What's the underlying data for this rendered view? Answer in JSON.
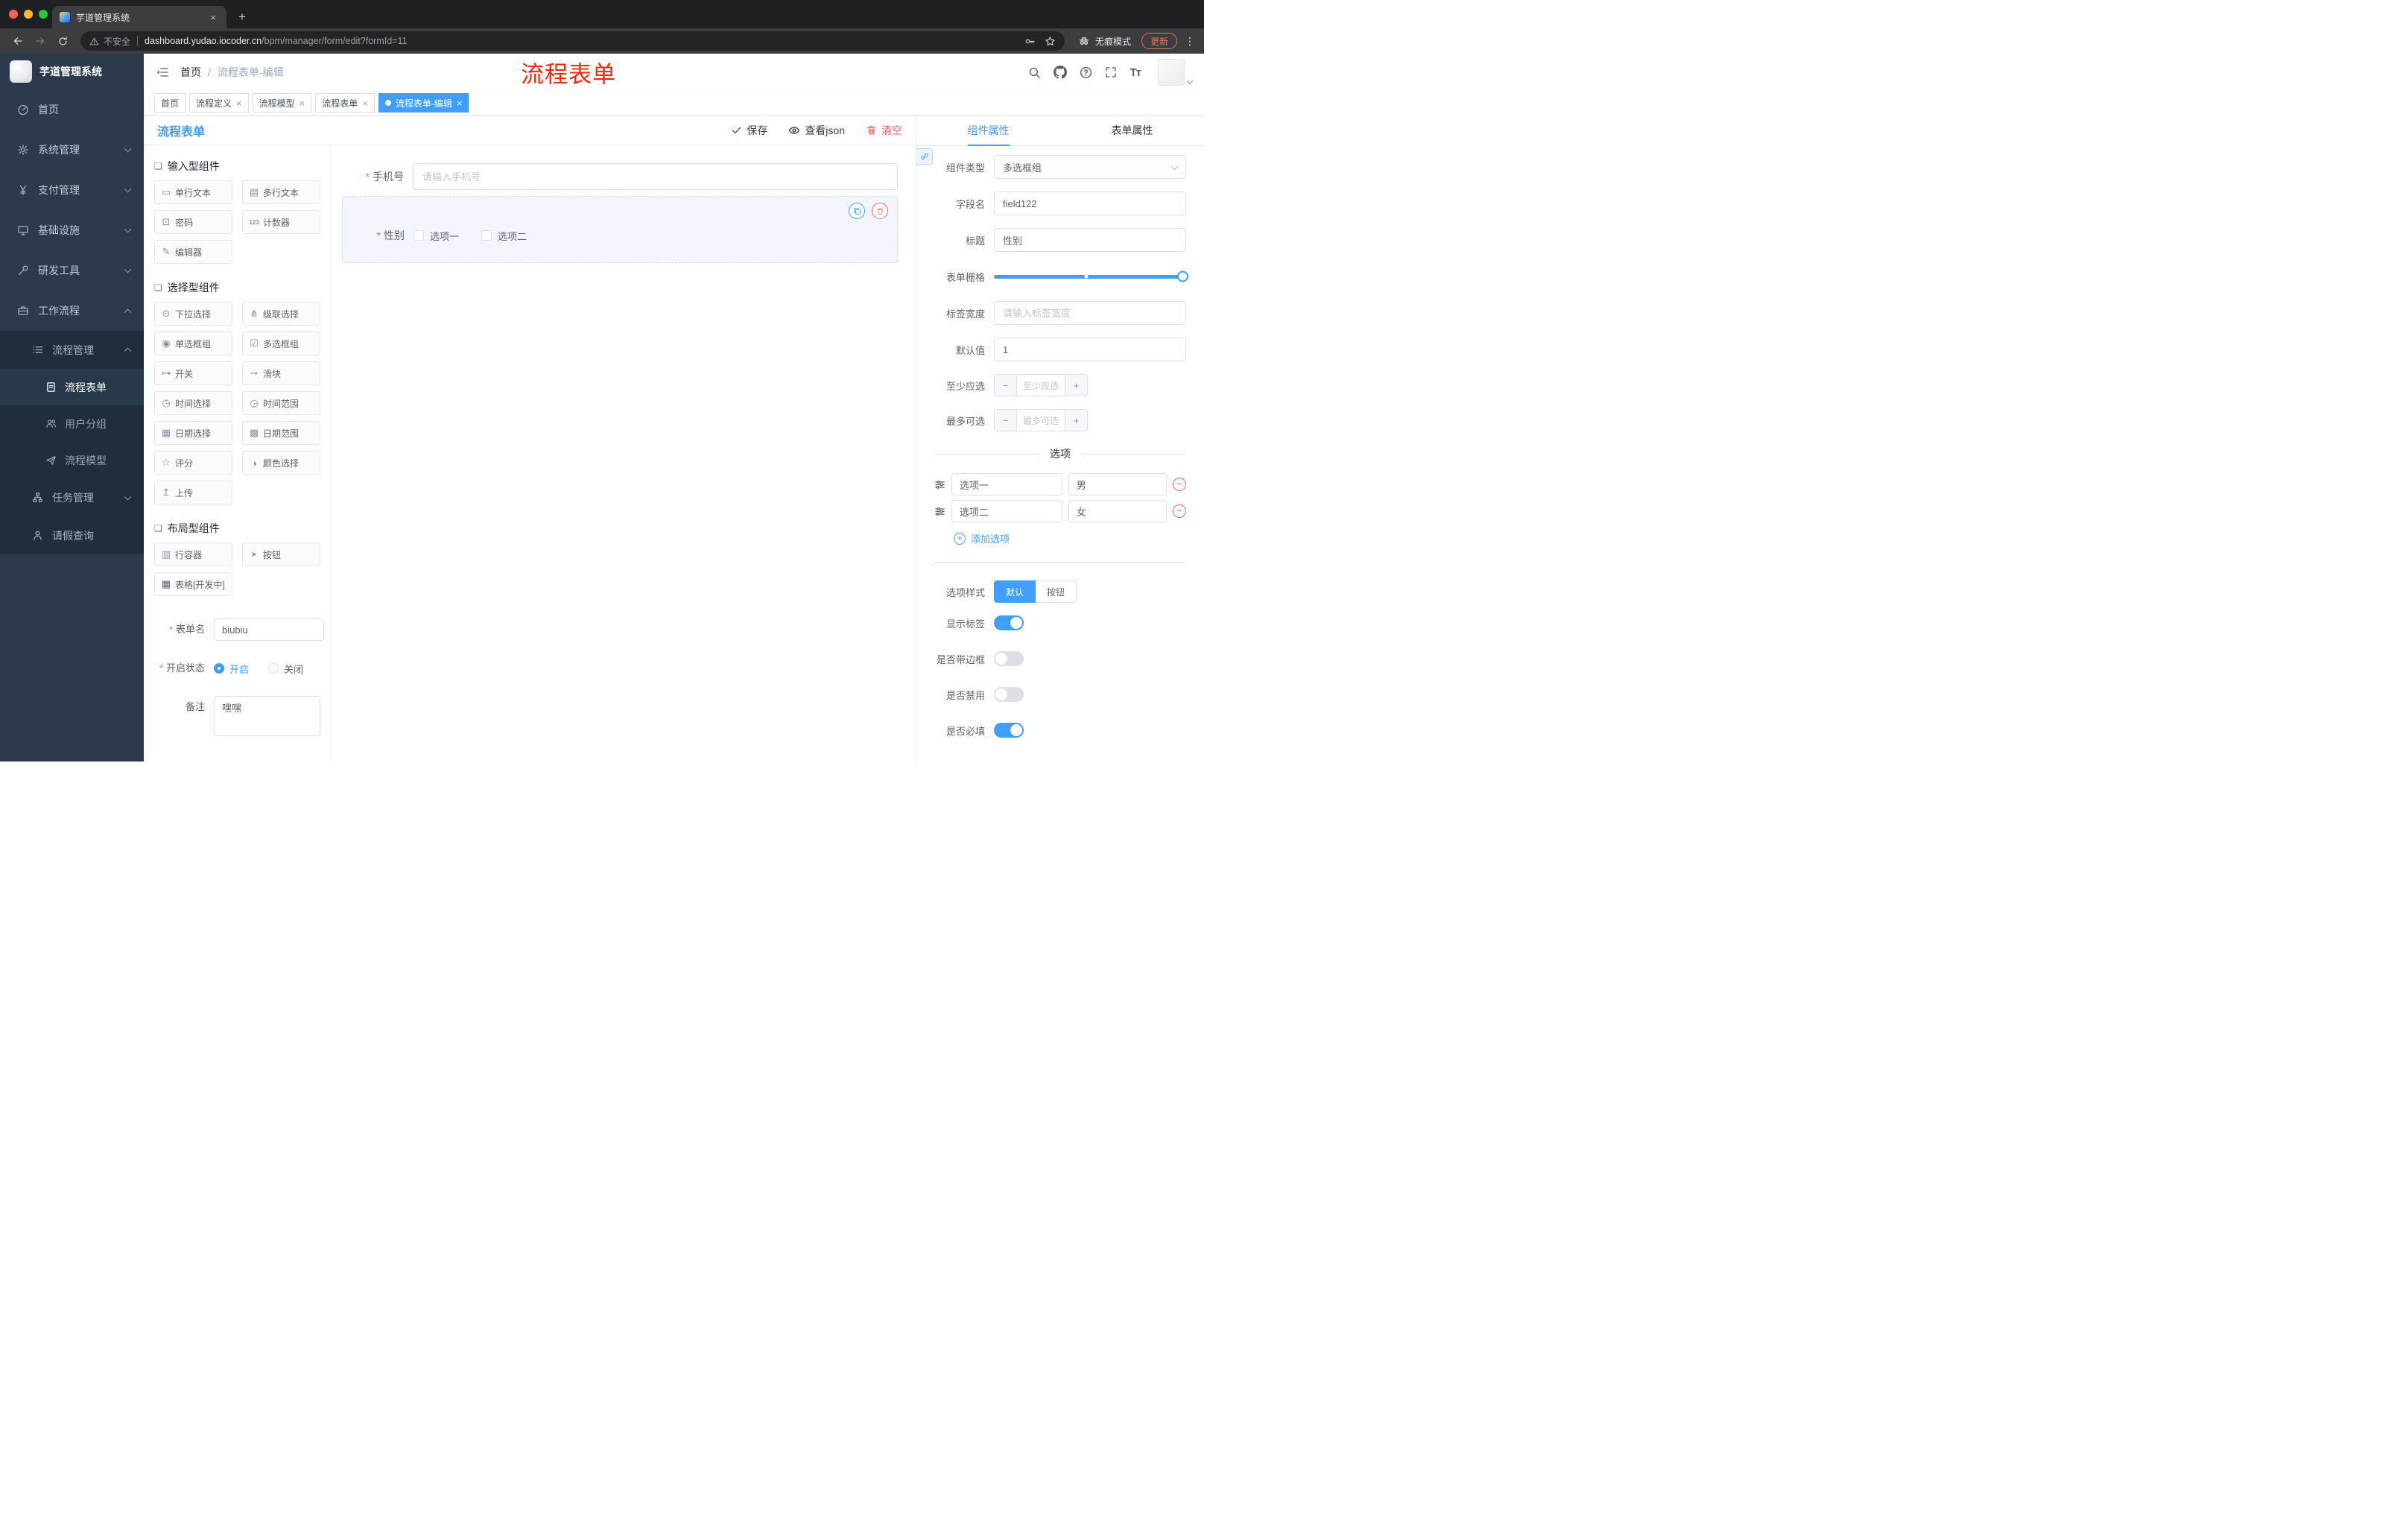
{
  "colors": {
    "primary": "#409EFF",
    "danger": "#F56C6C",
    "annotation": "#FF2404",
    "sidebar_bg": "#2D3A4B",
    "submenu_bg": "#1F2D3D"
  },
  "browser": {
    "tab_title": "芋道管理系统",
    "security_label": "不安全",
    "url_host": "dashboard.yudao.iocoder.cn",
    "url_path": "/bpm/manager/form/edit?formId=11",
    "incognito_label": "无痕模式",
    "update_label": "更新"
  },
  "sidebar": {
    "app_title": "芋道管理系统",
    "items": [
      {
        "label": "首页",
        "icon": "dashboard"
      },
      {
        "label": "系统管理",
        "icon": "gear",
        "expandable": true
      },
      {
        "label": "支付管理",
        "icon": "yen",
        "expandable": true
      },
      {
        "label": "基础设施",
        "icon": "monitor",
        "expandable": true
      },
      {
        "label": "研发工具",
        "icon": "wrench",
        "expandable": true
      },
      {
        "label": "工作流程",
        "icon": "briefcase",
        "expanded": true
      }
    ],
    "workflow_children": {
      "process_mgmt": {
        "label": "流程管理",
        "expanded": true
      },
      "process_children": [
        {
          "label": "流程表单",
          "active": true
        },
        {
          "label": "用户分组"
        },
        {
          "label": "流程模型"
        }
      ],
      "task_mgmt": {
        "label": "任务管理",
        "expandable": true
      },
      "leave_query": {
        "label": "请假查询"
      }
    }
  },
  "header": {
    "breadcrumb_home": "首页",
    "breadcrumb_current": "流程表单-编辑",
    "annotation": "流程表单"
  },
  "tags": [
    {
      "label": "首页",
      "closable": false,
      "active": false
    },
    {
      "label": "流程定义",
      "closable": true,
      "active": false
    },
    {
      "label": "流程模型",
      "closable": true,
      "active": false
    },
    {
      "label": "流程表单",
      "closable": true,
      "active": false
    },
    {
      "label": "流程表单-编辑",
      "closable": true,
      "active": true
    }
  ],
  "designer": {
    "title": "流程表单",
    "save_label": "保存",
    "view_json_label": "查看json",
    "clear_label": "清空"
  },
  "palette": {
    "groups": [
      {
        "title": "输入型组件",
        "items": [
          {
            "label": "单行文本",
            "icon": "single-line-input"
          },
          {
            "label": "多行文本",
            "icon": "multi-line-input"
          },
          {
            "label": "密码",
            "icon": "password"
          },
          {
            "label": "计数器",
            "icon": "counter"
          },
          {
            "label": "编辑器",
            "icon": "rich-editor"
          }
        ]
      },
      {
        "title": "选择型组件",
        "items": [
          {
            "label": "下拉选择",
            "icon": "select"
          },
          {
            "label": "级联选择",
            "icon": "cascader"
          },
          {
            "label": "单选框组",
            "icon": "radio-group"
          },
          {
            "label": "多选框组",
            "icon": "checkbox-group"
          },
          {
            "label": "开关",
            "icon": "switch"
          },
          {
            "label": "滑块",
            "icon": "slider"
          },
          {
            "label": "时间选择",
            "icon": "time-picker"
          },
          {
            "label": "时间范围",
            "icon": "time-range"
          },
          {
            "label": "日期选择",
            "icon": "date-picker"
          },
          {
            "label": "日期范围",
            "icon": "date-range"
          },
          {
            "label": "评分",
            "icon": "rate"
          },
          {
            "label": "颜色选择",
            "icon": "color-picker"
          },
          {
            "label": "上传",
            "icon": "upload"
          }
        ]
      },
      {
        "title": "布局型组件",
        "items": [
          {
            "label": "行容器",
            "icon": "row-container"
          },
          {
            "label": "按钮",
            "icon": "button"
          },
          {
            "label": "表格[开发中]",
            "icon": "table"
          }
        ]
      }
    ]
  },
  "meta_form": {
    "name_label": "表单名",
    "name_value": "biubiu",
    "status_label": "开启状态",
    "status_on_label": "开启",
    "status_off_label": "关闭",
    "status_selected": "开启",
    "remark_label": "备注",
    "remark_value": "嘿嘿"
  },
  "canvas": {
    "phone_field": {
      "label": "手机号",
      "required": true,
      "placeholder": "请输入手机号"
    },
    "gender_field": {
      "label": "性别",
      "required": true,
      "selected": true,
      "options": [
        {
          "label": "选项一"
        },
        {
          "label": "选项二"
        }
      ]
    }
  },
  "props": {
    "tabs": [
      {
        "label": "组件属性"
      },
      {
        "label": "表单属性"
      }
    ],
    "active_tab": "组件属性",
    "component_type": {
      "label": "组件类型",
      "value": "多选框组"
    },
    "field_name": {
      "label": "字段名",
      "value": "field122"
    },
    "title": {
      "label": "标题",
      "value": "性别"
    },
    "form_grid": {
      "label": "表单栅格"
    },
    "label_width": {
      "label": "标签宽度",
      "placeholder": "请输入标签宽度"
    },
    "default_value": {
      "label": "默认值",
      "value": "1"
    },
    "min_select": {
      "label": "至少应选",
      "placeholder": "至少应选"
    },
    "max_select": {
      "label": "最多可选",
      "placeholder": "最多可选"
    },
    "options_title": "选项",
    "options": [
      {
        "label": "选项一",
        "value": "男"
      },
      {
        "label": "选项二",
        "value": "女"
      }
    ],
    "add_option_label": "添加选项",
    "option_style": {
      "label": "选项样式",
      "choices": [
        {
          "label": "默认"
        },
        {
          "label": "按钮"
        }
      ],
      "selected": "默认"
    },
    "toggles": [
      {
        "label": "显示标签",
        "on": true
      },
      {
        "label": "是否带边框",
        "on": false
      },
      {
        "label": "是否禁用",
        "on": false
      },
      {
        "label": "是否必填",
        "on": true
      }
    ]
  }
}
